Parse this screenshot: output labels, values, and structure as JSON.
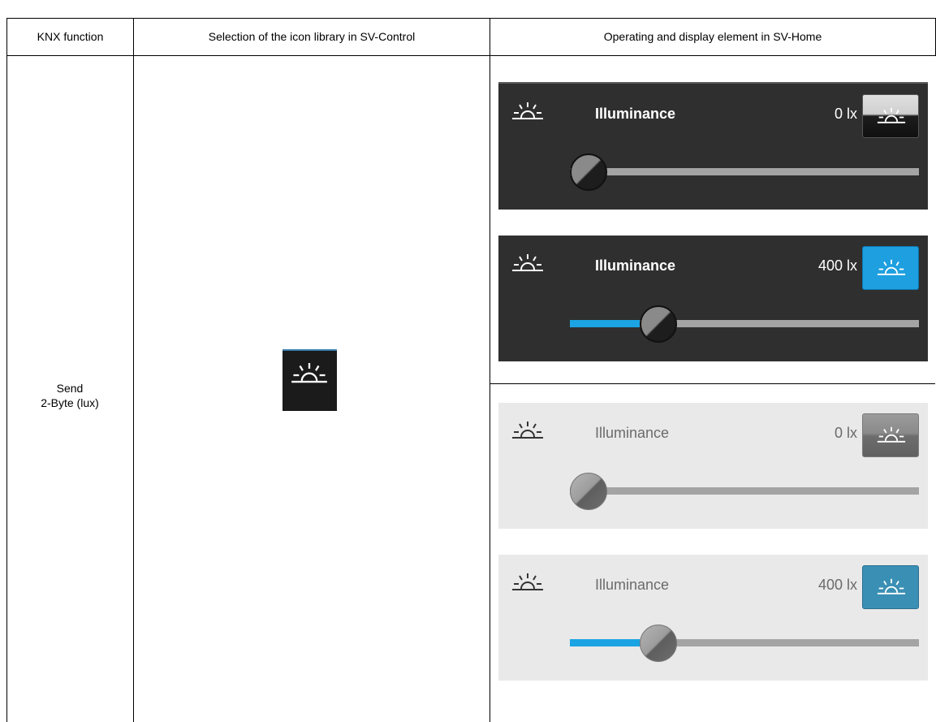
{
  "table": {
    "headers": [
      "KNX function",
      "Selection of the icon library in SV-Control",
      "Operating and display element in SV-Home"
    ],
    "function_lines": [
      "Send",
      "2-Byte (lux)"
    ],
    "library_icon": "sunrise-icon"
  },
  "colors": {
    "dark_panel": "#2f2f2f",
    "light_panel": "#e9e9e9",
    "accent_blue": "#1ba3e3",
    "track_grey": "#a4a4a4"
  },
  "panels": [
    {
      "theme": "dark",
      "label": "Illuminance",
      "value": "0 lx",
      "slider_fraction": 0.0,
      "button_state": "off",
      "icon": "sunrise-icon"
    },
    {
      "theme": "dark",
      "label": "Illuminance",
      "value": "400 lx",
      "slider_fraction": 0.2,
      "button_state": "on",
      "icon": "sunrise-icon"
    },
    {
      "theme": "light",
      "label": "Illuminance",
      "value": "0 lx",
      "slider_fraction": 0.0,
      "button_state": "off",
      "icon": "sunrise-icon"
    },
    {
      "theme": "light",
      "label": "Illuminance",
      "value": "400 lx",
      "slider_fraction": 0.2,
      "button_state": "on",
      "icon": "sunrise-icon"
    }
  ]
}
